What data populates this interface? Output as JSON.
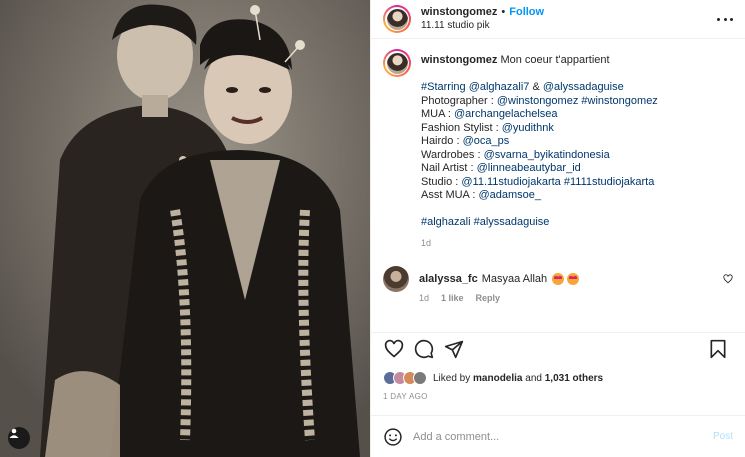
{
  "header": {
    "username": "winstongomez",
    "separator": "•",
    "follow_label": "Follow",
    "location": "11.11 studio pik"
  },
  "caption": {
    "username": "winstongomez",
    "title_text": "Mon coeur t'appartient",
    "lines": [
      {
        "parts": [
          {
            "t": "#Starring @alghazali7",
            "link": true
          },
          {
            "t": " & ",
            "link": false
          },
          {
            "t": "@alyssadaguise",
            "link": true
          }
        ]
      },
      {
        "parts": [
          {
            "t": "Photographer : ",
            "link": false
          },
          {
            "t": "@winstongomez #winstongomez",
            "link": true
          }
        ]
      },
      {
        "parts": [
          {
            "t": "MUA : ",
            "link": false
          },
          {
            "t": "@archangelachelsea",
            "link": true
          }
        ]
      },
      {
        "parts": [
          {
            "t": "Fashion Stylist : ",
            "link": false
          },
          {
            "t": "@yudithnk",
            "link": true
          }
        ]
      },
      {
        "parts": [
          {
            "t": "Hairdo : ",
            "link": false
          },
          {
            "t": "@oca_ps",
            "link": true
          }
        ]
      },
      {
        "parts": [
          {
            "t": "Wardrobes : ",
            "link": false
          },
          {
            "t": "@svarna_byikatindonesia",
            "link": true
          }
        ]
      },
      {
        "parts": [
          {
            "t": "Nail Artist : ",
            "link": false
          },
          {
            "t": "@linneabeautybar_id",
            "link": true
          }
        ]
      },
      {
        "parts": [
          {
            "t": "Studio : ",
            "link": false
          },
          {
            "t": "@11.11studiojakarta #1111studiojakarta",
            "link": true
          }
        ]
      },
      {
        "parts": [
          {
            "t": "Asst MUA : ",
            "link": false
          },
          {
            "t": "@adamsoe_",
            "link": true
          }
        ]
      },
      {
        "parts": []
      },
      {
        "parts": [
          {
            "t": "#alghazali #alyssadaguise",
            "link": true
          }
        ]
      }
    ],
    "age": "1d"
  },
  "comment": {
    "username": "alalyssa_fc",
    "text": "Masyaa Allah",
    "age": "1d",
    "likes": "1 like",
    "reply_label": "Reply"
  },
  "likes": {
    "prefix": "Liked by",
    "user": "manodelia",
    "conj": "and",
    "others": "1,031 others"
  },
  "timestamp": "1 DAY AGO",
  "add_comment": {
    "placeholder": "Add a comment...",
    "post_label": "Post"
  },
  "colors": {
    "link": "#00376b",
    "follow": "#0095f6",
    "muted": "#8e8e8e",
    "post_disabled": "#b2dffc"
  },
  "icons": [
    "user-tag-icon",
    "more-options-icon",
    "heart-icon",
    "comment-icon",
    "share-icon",
    "save-icon",
    "emoji-icon"
  ]
}
